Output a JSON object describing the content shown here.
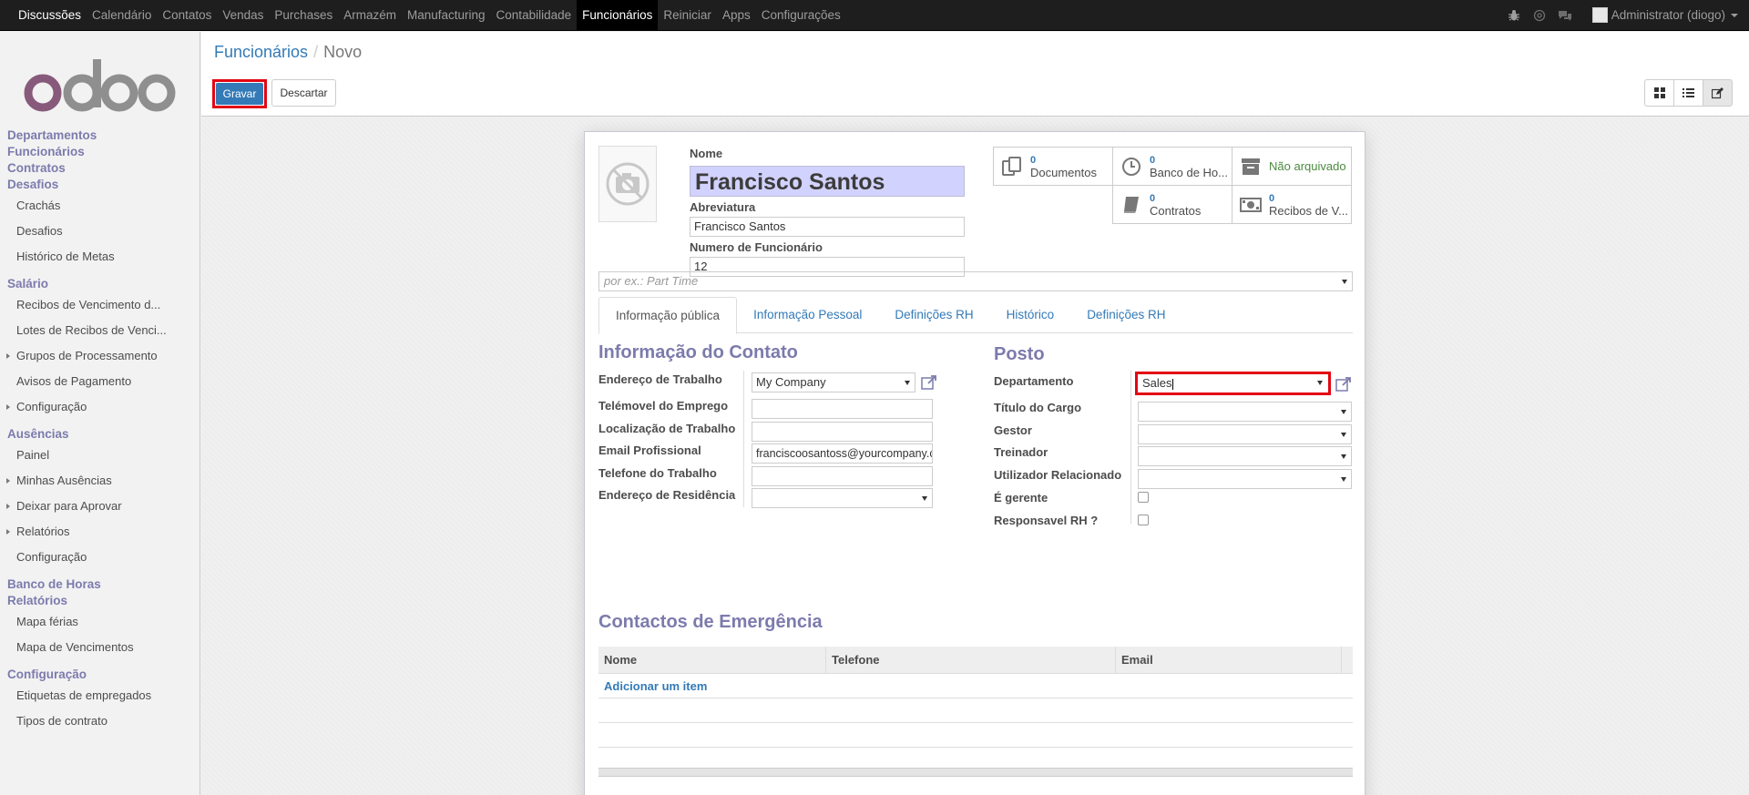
{
  "topbar": {
    "menu": [
      "Discussões",
      "Calendário",
      "Contatos",
      "Vendas",
      "Purchases",
      "Armazém",
      "Manufacturing",
      "Contabilidade",
      "Funcionários",
      "Reiniciar",
      "Apps",
      "Configurações"
    ],
    "active_menu": "Funcionários",
    "user": "Administrator (diogo)"
  },
  "sidebar": {
    "logo_text": "odoo",
    "s_departamentos": "Departamentos",
    "s_funcionarios": "Funcionários",
    "s_contratos": "Contratos",
    "s_desafios": "Desafios",
    "crachas": "Crachás",
    "desafios": "Desafios",
    "historico_metas": "Histórico de Metas",
    "s_salario": "Salário",
    "recibos_venc": "Recibos de Vencimento d...",
    "lotes_recibos": "Lotes de Recibos de Venci...",
    "grupos_proc": "Grupos de Processamento",
    "avisos_pag": "Avisos de Pagamento",
    "configuracao1": "Configuração",
    "s_ausencias": "Ausências",
    "painel": "Painel",
    "minhas_ausencias": "Minhas Ausências",
    "deixar_aprovar": "Deixar para Aprovar",
    "relatorios": "Relatórios",
    "configuracao2": "Configuração",
    "s_banco_horas": "Banco de Horas",
    "s_relatorios": "Relatórios",
    "mapa_ferias": "Mapa férias",
    "mapa_venc": "Mapa de Vencimentos",
    "s_configuracao": "Configuração",
    "etiquetas": "Etiquetas de empregados",
    "tipos_contrato": "Tipos de contrato"
  },
  "breadcrumb": {
    "parent": "Funcionários",
    "sep": "/",
    "current": "Novo"
  },
  "buttons": {
    "save": "Gravar",
    "discard": "Descartar"
  },
  "form": {
    "name_label": "Nome",
    "name_value": "Francisco Santos",
    "abbr_label": "Abreviatura",
    "abbr_value": "Francisco Santos",
    "num_label": "Numero de Funcionário",
    "num_value": "12",
    "category_placeholder": "por ex.: Part Time",
    "smart": {
      "docs_count": "0",
      "docs_label": "Documentos",
      "hours_count": "0",
      "hours_label": "Banco de Ho...",
      "archive_label": "Não arquivado",
      "contracts_count": "0",
      "contracts_label": "Contratos",
      "payslips_count": "0",
      "payslips_label": "Recibos de V..."
    },
    "tabs": [
      "Informação pública",
      "Informação Pessoal",
      "Definições RH",
      "Histórico",
      "Definições RH"
    ],
    "contact": {
      "title": "Informação do Contato",
      "work_address_label": "Endereço de Trabalho",
      "work_address_value": "My Company",
      "mobile_label": "Telémovel do Emprego",
      "mobile_value": "",
      "location_label": "Localização de Trabalho",
      "location_value": "",
      "email_label": "Email Profissional",
      "email_value": "franciscoosantoss@yourcompany.com",
      "phone_label": "Telefone do Trabalho",
      "phone_value": "",
      "home_label": "Endereço de Residência",
      "home_value": ""
    },
    "position": {
      "title": "Posto",
      "dept_label": "Departamento",
      "dept_value": "Sales",
      "job_label": "Título do Cargo",
      "manager_label": "Gestor",
      "coach_label": "Treinador",
      "user_label": "Utilizador Relacionado",
      "is_manager_label": "É gerente",
      "hr_resp_label": "Responsavel RH ?"
    },
    "emergency": {
      "title": "Contactos de Emergência",
      "columns": [
        "Nome",
        "Telefone",
        "Email"
      ],
      "add_item": "Adicionar um item"
    }
  },
  "colors": {
    "accent": "#7c7bad",
    "primary": "#337ab7",
    "highlight": "#e30613"
  }
}
